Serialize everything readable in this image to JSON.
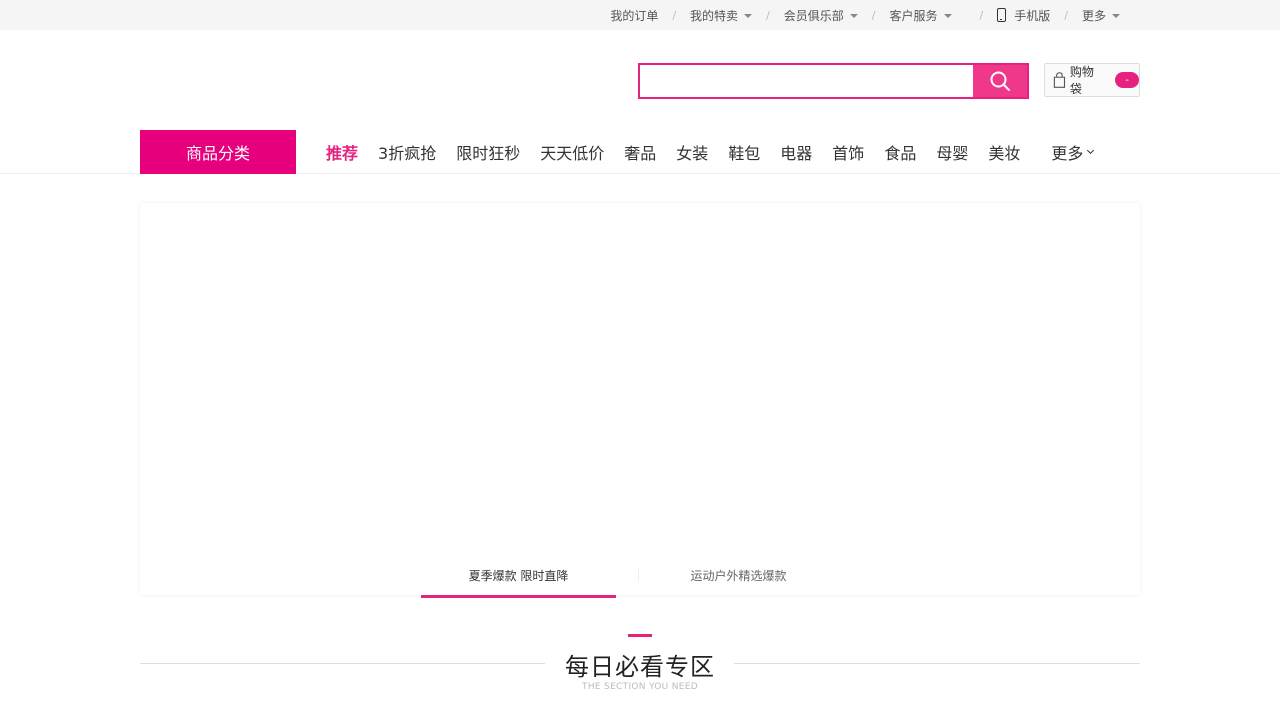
{
  "topbar": {
    "links": [
      {
        "label": "我的订单",
        "has_caret": false
      },
      {
        "label": "我的特卖",
        "has_caret": true
      },
      {
        "label": "会员俱乐部",
        "has_caret": true
      },
      {
        "label": "客户服务",
        "has_caret": true
      },
      {
        "label": "手机版",
        "has_caret": false,
        "icon": "phone-icon"
      },
      {
        "label": "更多",
        "has_caret": true
      }
    ],
    "separator": "/"
  },
  "search": {
    "value": "",
    "placeholder": "",
    "icon": "search-icon"
  },
  "cart": {
    "label": "购物袋",
    "count": "-",
    "icon": "bag-icon"
  },
  "nav": {
    "category_label": "商品分类",
    "items": [
      "推荐",
      "3折疯抢",
      "限时狂秒",
      "天天低价",
      "奢品",
      "女装",
      "鞋包",
      "电器",
      "首饰",
      "食品",
      "母婴",
      "美妆"
    ],
    "active_index": 0,
    "more_label": "更多"
  },
  "banner": {
    "tabs": [
      "夏季爆款 限时直降",
      "运动户外精选爆款"
    ],
    "active_tab": 0
  },
  "section": {
    "title": "每日必看专区",
    "subtitle": "THE SECTION YOU NEED"
  },
  "colors": {
    "accent": "#e5237f",
    "category_bg": "#e6007e",
    "search_button": "#f0388a",
    "topbar_bg": "#f5f5f5"
  }
}
